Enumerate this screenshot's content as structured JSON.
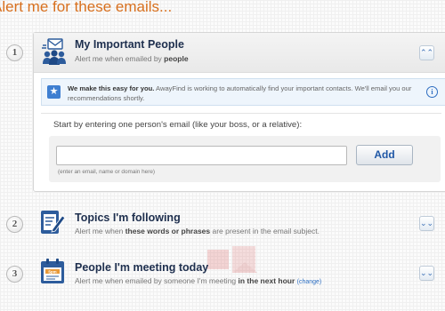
{
  "page": {
    "title": "Alert me for these emails..."
  },
  "sections": [
    {
      "number": "1",
      "title": "My Important People",
      "subtitle_prefix": "Alert me when emailed by ",
      "subtitle_bold": "people",
      "icon": "people-mail-icon",
      "toggle_icon": "chevron-up-icon",
      "expanded": true
    },
    {
      "number": "2",
      "title": "Topics I'm following",
      "subtitle_prefix": "Alert me when ",
      "subtitle_bold": "these words or phrases",
      "subtitle_suffix": " are present in the email subject.",
      "icon": "document-pen-icon",
      "toggle_icon": "chevron-down-icon",
      "expanded": false
    },
    {
      "number": "3",
      "title": "People I'm meeting today",
      "subtitle_prefix": "Alert me when emailed by someone I'm meeting ",
      "subtitle_bold": "in the next hour",
      "subtitle_link": "(change)",
      "icon": "calendar-icon",
      "calendar_text": "5pm",
      "toggle_icon": "chevron-down-icon",
      "expanded": false
    }
  ],
  "info": {
    "bold": "We make this easy for you.",
    "text": " AwayFind is working to automatically find your important contacts. We'll email you our recommendations shortly."
  },
  "entry": {
    "prompt": "Start by entering one person's email (like your boss, or a relative):",
    "input_value": "",
    "add_label": "Add",
    "hint": "(enter an email, name or domain here)"
  },
  "colors": {
    "title_orange": "#d8701e",
    "heading_navy": "#1e2f4e",
    "accent_blue": "#3f7fd1",
    "info_bg": "#eef5fc"
  }
}
